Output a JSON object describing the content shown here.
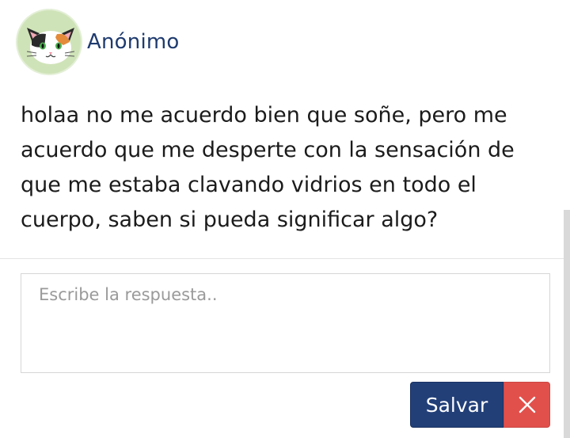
{
  "post": {
    "author": "Anónimo",
    "avatar_icon": "cat-face-icon",
    "text": "holaa no me acuerdo bien que soñe, pero me acuerdo que me desperte con la sensación de que me estaba clavando vidrios en todo el cuerpo, saben si pueda significar algo?"
  },
  "reply": {
    "placeholder": "Escribe la respuesta..",
    "value": ""
  },
  "actions": {
    "save_label": "Salvar",
    "close_icon": "close-icon"
  },
  "colors": {
    "author": "#1f3b6e",
    "save_button": "#223f78",
    "close_button": "#e2504c",
    "avatar_bg": "#cfe3b8"
  }
}
